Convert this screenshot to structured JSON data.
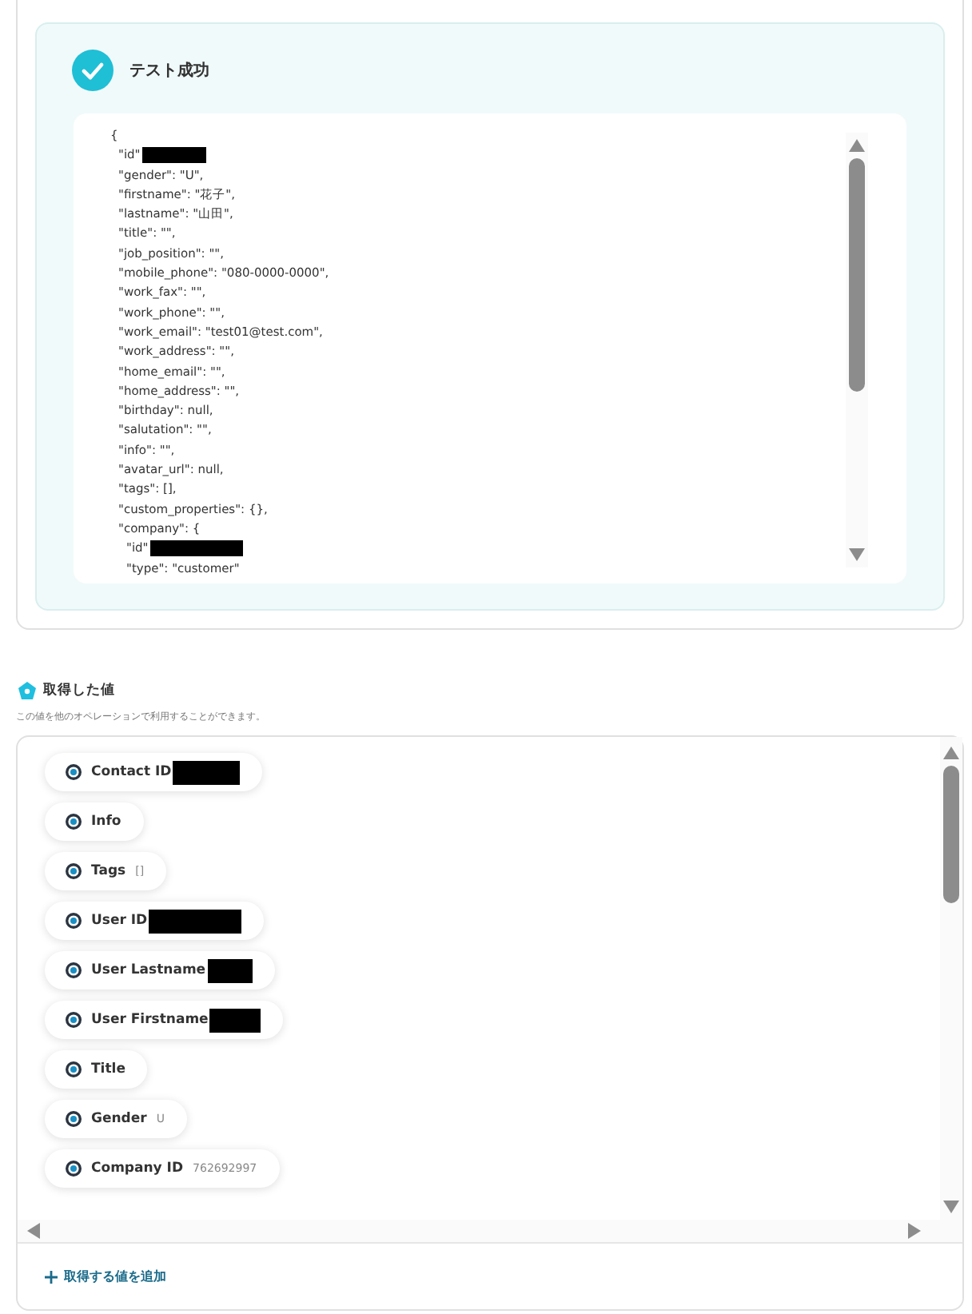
{
  "test_result": {
    "title": "テスト成功",
    "code_lines": [
      {
        "text": "{",
        "children": [
          {
            "text": "\"id\"",
            "redacted": true
          },
          {
            "text": "\"gender\": \"U\","
          },
          {
            "text": "\"firstname\": \"花子\","
          },
          {
            "text": "\"lastname\": \"山田\","
          },
          {
            "text": "\"title\": \"\","
          },
          {
            "text": "\"job_position\": \"\","
          },
          {
            "text": "\"mobile_phone\": \"080-0000-0000\","
          },
          {
            "text": "\"work_fax\": \"\","
          },
          {
            "text": "\"work_phone\": \"\","
          },
          {
            "text": "\"work_email\": \"test01@test.com\","
          },
          {
            "text": "\"work_address\": \"\","
          },
          {
            "text": "\"home_email\": \"\","
          },
          {
            "text": "\"home_address\": \"\","
          },
          {
            "text": "\"birthday\": null,"
          },
          {
            "text": "\"salutation\": \"\","
          },
          {
            "text": "\"info\": \"\","
          },
          {
            "text": "\"avatar_url\": null,"
          },
          {
            "text": "\"tags\": [],"
          },
          {
            "text": "\"custom_properties\": {},"
          },
          {
            "text": "\"company\": {",
            "children": [
              {
                "text": "\"id\"",
                "redacted": true
              },
              {
                "text": "\"type\": \"customer\""
              }
            ]
          }
        ]
      }
    ]
  },
  "fetched_values": {
    "title": "取得した値",
    "description": "この値を他のオペレーションで利用することができます。",
    "items": [
      {
        "label": "Contact ID",
        "redacted": true
      },
      {
        "label": "Info"
      },
      {
        "label": "Tags",
        "value": "[]"
      },
      {
        "label": "User ID",
        "redacted": true
      },
      {
        "label": "User Lastname",
        "redacted": true
      },
      {
        "label": "User Firstname",
        "redacted": true
      },
      {
        "label": "Title"
      },
      {
        "label": "Gender",
        "value": "U"
      },
      {
        "label": "Company ID",
        "value": "762692997"
      }
    ],
    "add_link": "取得する値を追加"
  }
}
